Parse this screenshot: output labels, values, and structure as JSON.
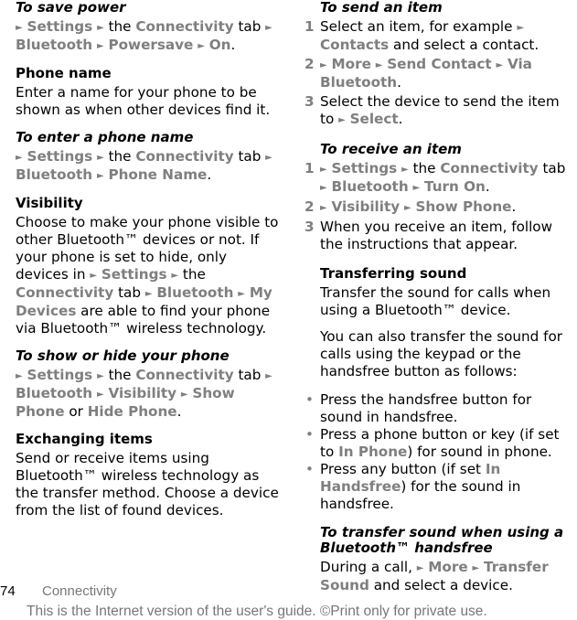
{
  "left": {
    "save_power": {
      "heading": "To save power",
      "path": [
        "Settings",
        "the",
        "Connectivity",
        "tab",
        "Bluetooth",
        "Powersave",
        "On"
      ]
    },
    "phone_name": {
      "heading": "Phone name",
      "text": "Enter a name for your phone to be shown as when other devices find it."
    },
    "enter_phone_name": {
      "heading": "To enter a phone name",
      "path": [
        "Settings",
        "the",
        "Connectivity",
        "tab",
        "Bluetooth",
        "Phone Name"
      ]
    },
    "visibility": {
      "heading": "Visibility",
      "text_before": "Choose to make your phone visible to other Bluetooth™  devices or not. If your phone is set to hide, only devices in ",
      "path": [
        "Settings",
        "the",
        "Connectivity",
        "tab",
        "Bluetooth",
        "My Devices"
      ],
      "text_after": " are able to find your phone via Bluetooth™ wireless technology."
    },
    "show_hide": {
      "heading": "To show or hide your phone",
      "path": [
        "Settings",
        "the",
        "Connectivity",
        "tab",
        "Bluetooth",
        "Visibility",
        "Show Phone"
      ],
      "or_word": "or",
      "alt": "Hide Phone"
    },
    "exchanging": {
      "heading": "Exchanging items",
      "text": "Send or receive items using Bluetooth™  wireless technology as the transfer method. Choose a device from the list of found devices."
    }
  },
  "right": {
    "send_item": {
      "heading": "To send an item",
      "steps": [
        {
          "num": "1",
          "text_before": "Select an item, for example ",
          "menu": "Contacts",
          "text_after": " and select a contact."
        },
        {
          "num": "2",
          "menu1": "More",
          "menu2": "Send Contact",
          "menu3": "Via Bluetooth"
        },
        {
          "num": "3",
          "text_before": "Select the device to send the item to ",
          "menu": "Select"
        }
      ]
    },
    "receive_item": {
      "heading": "To receive an item",
      "steps": [
        {
          "num": "1",
          "menu1": "Settings",
          "the": "the",
          "menu2": "Connectivity",
          "tab": "tab",
          "menu3": "Bluetooth",
          "menu4": "Turn On"
        },
        {
          "num": "2",
          "menu1": "Visibility",
          "menu2": "Show Phone"
        },
        {
          "num": "3",
          "text": "When you receive an item, follow the instructions that appear."
        }
      ]
    },
    "transferring": {
      "heading": "Transferring sound",
      "text1": "Transfer the sound for calls when using a Bluetooth™  device.",
      "text2": "You can also transfer the sound for calls using the keypad or the handsfree button as follows:",
      "bullets": [
        {
          "text": "Press the handsfree button for sound in handsfree."
        },
        {
          "text_before": "Press a phone button or key (if set to ",
          "menu": "In Phone",
          "text_after": ") for sound in phone."
        },
        {
          "text_before": "Press any button (if set ",
          "menu": "In Handsfree",
          "text_after": ") for the sound in handsfree."
        }
      ]
    },
    "transfer_handsfree": {
      "heading": "To transfer sound when using a Bluetooth™  handsfree",
      "text_before": "During a call, ",
      "menu1": "More",
      "menu2": "Transfer Sound",
      "text_after": " and select a device."
    }
  },
  "footer": {
    "page_number": "74",
    "section": "Connectivity",
    "note": "This is the Internet version of the user's guide. ©Print only for private use."
  },
  "icons": {
    "arrow": "►",
    "bullet": "•"
  },
  "colors": {
    "menu_gray": "#7f7f7f",
    "text": "#000000",
    "footer_gray": "#777777"
  }
}
